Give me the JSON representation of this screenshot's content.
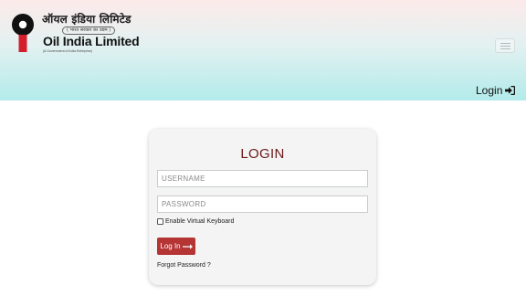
{
  "header": {
    "logo_hindi": "ऑयल इंडिया लिमिटेड",
    "logo_tagline": "( भारत सरकार का उद्यम )",
    "logo_name": "Oil India Limited",
    "logo_sub": "(A Government of India Enterprise)",
    "login_label": "Login"
  },
  "login_form": {
    "title": "LOGIN",
    "username_placeholder": "USERNAME",
    "password_placeholder": "PASSWORD",
    "virtual_keyboard_label": "Enable Virtual Keyboard",
    "virtual_keyboard_checked": false,
    "submit_label": "Log In",
    "forgot_label": "Forgot Password ?"
  },
  "colors": {
    "header_top": "#fdeaea",
    "header_bottom": "#b2ebea",
    "title": "#6b1a1a",
    "button": "#b53434",
    "card_background": "#f3f4f3"
  },
  "icons": {
    "login": "sign-in-icon",
    "submit": "long-arrow-right-icon",
    "menu": "hamburger-icon"
  }
}
